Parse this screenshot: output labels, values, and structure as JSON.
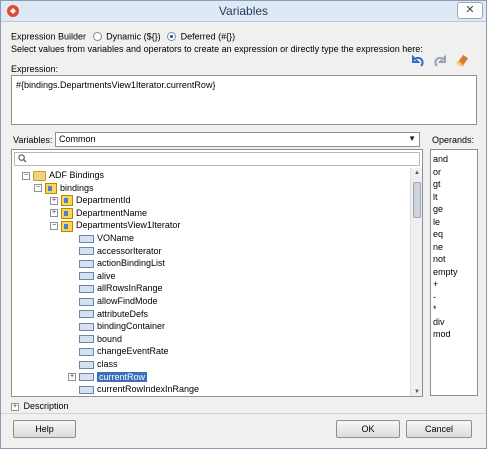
{
  "window": {
    "title": "Variables",
    "close_glyph": "✕"
  },
  "expression_builder": {
    "label": "Expression Builder",
    "options": [
      {
        "label": "Dynamic (${})",
        "selected": false
      },
      {
        "label": "Deferred (#{})",
        "selected": true
      }
    ]
  },
  "instructions": "Select values from variables and operators to create an expression or directly type the expression here:",
  "toolbar_icons": [
    "undo-icon",
    "redo-icon",
    "clear-icon"
  ],
  "expression": {
    "label": "Expression:",
    "value": "#{bindings.DepartmentsView1Iterator.currentRow}"
  },
  "variables": {
    "label": "Variables:",
    "selected": "Common",
    "tree": [
      {
        "label": "ADF Bindings",
        "level": 0,
        "expander": "−",
        "icon": "folder"
      },
      {
        "label": "bindings",
        "level": 1,
        "expander": "−",
        "icon": "binding"
      },
      {
        "label": "DepartmentId",
        "level": 2,
        "expander": "+",
        "icon": "binding"
      },
      {
        "label": "DepartmentName",
        "level": 2,
        "expander": "+",
        "icon": "binding"
      },
      {
        "label": "DepartmentsView1Iterator",
        "level": 2,
        "expander": "−",
        "icon": "binding"
      },
      {
        "label": "VOName",
        "level": 3,
        "expander": "",
        "icon": "attribute"
      },
      {
        "label": "accessorIterator",
        "level": 3,
        "expander": "",
        "icon": "attribute"
      },
      {
        "label": "actionBindingList",
        "level": 3,
        "expander": "",
        "icon": "attribute"
      },
      {
        "label": "alive",
        "level": 3,
        "expander": "",
        "icon": "attribute"
      },
      {
        "label": "allRowsInRange",
        "level": 3,
        "expander": "",
        "icon": "attribute"
      },
      {
        "label": "allowFindMode",
        "level": 3,
        "expander": "",
        "icon": "attribute"
      },
      {
        "label": "attributeDefs",
        "level": 3,
        "expander": "",
        "icon": "attribute"
      },
      {
        "label": "bindingContainer",
        "level": 3,
        "expander": "",
        "icon": "attribute"
      },
      {
        "label": "bound",
        "level": 3,
        "expander": "",
        "icon": "attribute"
      },
      {
        "label": "changeEventRate",
        "level": 3,
        "expander": "",
        "icon": "attribute"
      },
      {
        "label": "class",
        "level": 3,
        "expander": "",
        "icon": "attribute"
      },
      {
        "label": "currentRow",
        "level": 3,
        "expander": "+",
        "icon": "attribute",
        "selected": true
      },
      {
        "label": "currentRowIndexInRange",
        "level": 3,
        "expander": "",
        "icon": "attribute"
      }
    ]
  },
  "operands": {
    "label": "Operands:",
    "items": [
      "and",
      "or",
      "gt",
      "lt",
      "ge",
      "le",
      "eq",
      "ne",
      "not",
      "empty",
      "+",
      "-",
      "*",
      "div",
      "mod"
    ]
  },
  "description": {
    "label": "Description",
    "expander": "+"
  },
  "buttons": {
    "help": "Help",
    "ok": "OK",
    "cancel": "Cancel"
  }
}
